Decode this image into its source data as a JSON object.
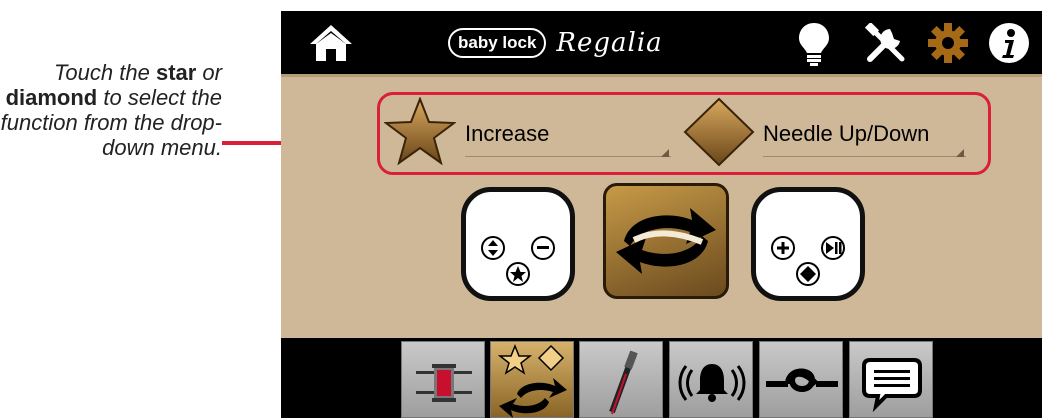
{
  "callout": {
    "text_1": "Touch the ",
    "bold_1": "star",
    "text_2": " or ",
    "bold_2": "diamond",
    "text_3": " to select the function from the drop-down menu."
  },
  "header": {
    "brand_pill": "baby lock",
    "brand_script": "Regalia",
    "icons": [
      "home-icon",
      "lightbulb-icon",
      "tools-icon",
      "gear-icon",
      "info-icon"
    ]
  },
  "functions": {
    "star_value": "Increase",
    "diamond_value": "Needle Up/Down"
  },
  "tabs": [
    "spool-tab",
    "star-diamond-tab",
    "needle-tab",
    "bell-tab",
    "knot-tab",
    "message-tab"
  ],
  "colors": {
    "highlight_red": "#d91f3a",
    "panel_tan": "#cfb898",
    "gold": "#b8863b",
    "active_gear": "#a66a16"
  }
}
